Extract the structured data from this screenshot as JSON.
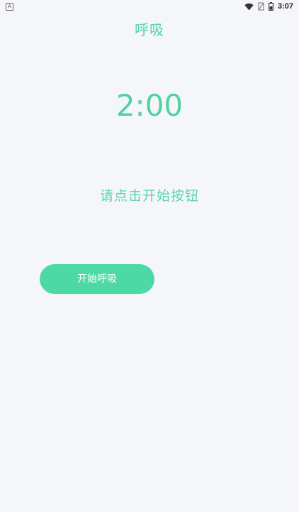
{
  "status_bar": {
    "left_icon_label": "A",
    "time": "3:07",
    "icons": [
      "wifi-icon",
      "no-sim-icon",
      "battery-icon"
    ]
  },
  "header": {
    "title": "呼吸"
  },
  "timer": {
    "display": "2:00"
  },
  "instruction": {
    "text": "请点击开始按钮"
  },
  "actions": {
    "start_label": "开始呼吸"
  },
  "colors": {
    "accent": "#4cd9a5",
    "background": "#f5f6fa",
    "button_text": "#ffffff"
  }
}
